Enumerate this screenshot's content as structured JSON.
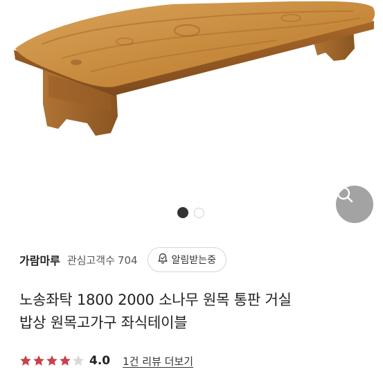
{
  "product": {
    "image_alt": "wooden low table product photo",
    "gallery": {
      "total": 2,
      "active_index": 0
    }
  },
  "icons": {
    "zoom": "search-icon",
    "bell": "bell-icon",
    "star": "star-icon"
  },
  "seller": {
    "name": "가람마루",
    "fans_label": "관심고객수",
    "fans_count": "704",
    "notify_label": "알림받는중"
  },
  "title": {
    "line1": "노송좌탁 1800 2000 소나무 원목 통판 거실",
    "line2": "밥상 원목고가구 좌식테이블"
  },
  "rating": {
    "score": "4.0",
    "score_value": 4,
    "max": 5,
    "reviews_link": "1건 리뷰 더보기"
  },
  "colors": {
    "star_filled": "#c8424c",
    "star_empty": "#d8d8d8",
    "zoom_bg": "#9a9a9a",
    "dot_active": "#333333"
  }
}
